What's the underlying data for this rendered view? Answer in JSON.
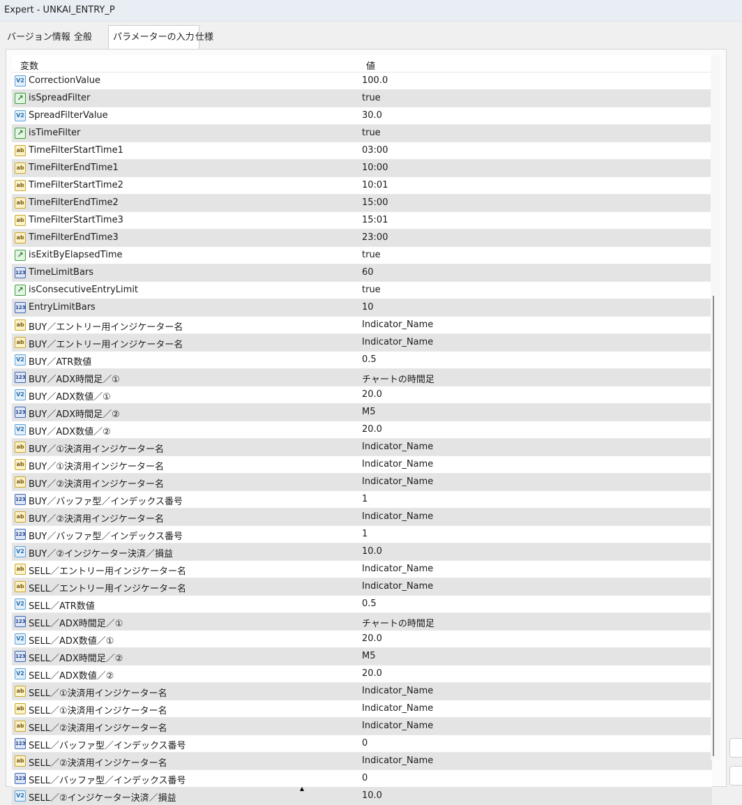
{
  "window": {
    "title": "Expert - UNKAI_ENTRY_P"
  },
  "tabs": [
    {
      "label": "バージョン情報"
    },
    {
      "label": "全般"
    },
    {
      "label": "パラメーターの入力",
      "active": true
    },
    {
      "label": "仕様"
    }
  ],
  "table": {
    "headers": {
      "name": "変数",
      "value": "値"
    },
    "icon_labels": {
      "bool": "↗",
      "double": "V2",
      "string": "ab",
      "int": "123"
    },
    "rows": [
      {
        "type": "double",
        "name": "CorrectionValue",
        "value": "100.0"
      },
      {
        "type": "bool",
        "name": "isSpreadFilter",
        "value": "true"
      },
      {
        "type": "double",
        "name": "SpreadFilterValue",
        "value": "30.0"
      },
      {
        "type": "bool",
        "name": "isTimeFilter",
        "value": "true"
      },
      {
        "type": "string",
        "name": "TimeFilterStartTime1",
        "value": "03:00"
      },
      {
        "type": "string",
        "name": "TimeFilterEndTime1",
        "value": "10:00"
      },
      {
        "type": "string",
        "name": "TimeFilterStartTime2",
        "value": "10:01"
      },
      {
        "type": "string",
        "name": "TimeFilterEndTime2",
        "value": "15:00"
      },
      {
        "type": "string",
        "name": "TimeFilterStartTime3",
        "value": "15:01"
      },
      {
        "type": "string",
        "name": "TimeFilterEndTime3",
        "value": "23:00"
      },
      {
        "type": "bool",
        "name": "isExitByElapsedTime",
        "value": "true"
      },
      {
        "type": "int",
        "name": "TimeLimitBars",
        "value": "60"
      },
      {
        "type": "bool",
        "name": "isConsecutiveEntryLimit",
        "value": "true"
      },
      {
        "type": "int",
        "name": "EntryLimitBars",
        "value": "10"
      },
      {
        "type": "string",
        "name": "BUY／エントリー用インジケーター名",
        "value": "Indicator_Name"
      },
      {
        "type": "string",
        "name": "BUY／エントリー用インジケーター名",
        "value": "Indicator_Name"
      },
      {
        "type": "double",
        "name": "BUY／ATR数値",
        "value": "0.5"
      },
      {
        "type": "int",
        "name": "BUY／ADX時間足／①",
        "value": "チャートの時間足"
      },
      {
        "type": "double",
        "name": "BUY／ADX数値／①",
        "value": "20.0"
      },
      {
        "type": "int",
        "name": "BUY／ADX時間足／②",
        "value": "M5"
      },
      {
        "type": "double",
        "name": "BUY／ADX数値／②",
        "value": "20.0"
      },
      {
        "type": "string",
        "name": "BUY／①決済用インジケーター名",
        "value": "Indicator_Name"
      },
      {
        "type": "string",
        "name": "BUY／①決済用インジケーター名",
        "value": "Indicator_Name"
      },
      {
        "type": "string",
        "name": "BUY／②決済用インジケーター名",
        "value": "Indicator_Name"
      },
      {
        "type": "int",
        "name": "BUY／バッファ型／インデックス番号",
        "value": "1"
      },
      {
        "type": "string",
        "name": "BUY／②決済用インジケーター名",
        "value": "Indicator_Name"
      },
      {
        "type": "int",
        "name": "BUY／バッファ型／インデックス番号",
        "value": "1"
      },
      {
        "type": "double",
        "name": "BUY／②インジケーター決済／損益",
        "value": "10.0"
      },
      {
        "type": "string",
        "name": "SELL／エントリー用インジケーター名",
        "value": "Indicator_Name"
      },
      {
        "type": "string",
        "name": "SELL／エントリー用インジケーター名",
        "value": "Indicator_Name"
      },
      {
        "type": "double",
        "name": "SELL／ATR数値",
        "value": "0.5"
      },
      {
        "type": "int",
        "name": "SELL／ADX時間足／①",
        "value": "チャートの時間足"
      },
      {
        "type": "double",
        "name": "SELL／ADX数値／①",
        "value": "20.0"
      },
      {
        "type": "int",
        "name": "SELL／ADX時間足／②",
        "value": "M5"
      },
      {
        "type": "double",
        "name": "SELL／ADX数値／②",
        "value": "20.0"
      },
      {
        "type": "string",
        "name": "SELL／①決済用インジケーター名",
        "value": "Indicator_Name"
      },
      {
        "type": "string",
        "name": "SELL／①決済用インジケーター名",
        "value": "Indicator_Name"
      },
      {
        "type": "string",
        "name": "SELL／②決済用インジケーター名",
        "value": "Indicator_Name"
      },
      {
        "type": "int",
        "name": "SELL／バッファ型／インデックス番号",
        "value": "0"
      },
      {
        "type": "string",
        "name": "SELL／②決済用インジケーター名",
        "value": "Indicator_Name"
      },
      {
        "type": "int",
        "name": "SELL／バッファ型／インデックス番号",
        "value": "0"
      },
      {
        "type": "double",
        "name": "SELL／②インジケーター決済／損益",
        "value": "10.0"
      }
    ]
  }
}
